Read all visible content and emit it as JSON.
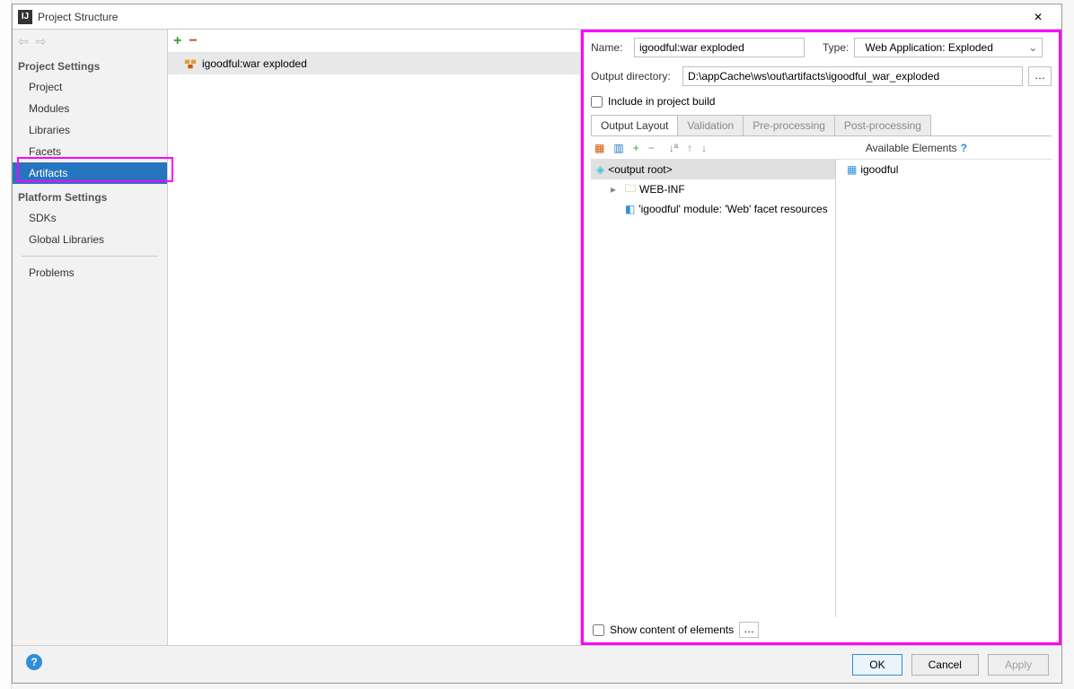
{
  "window": {
    "title": "Project Structure"
  },
  "sidebar": {
    "section1": "Project Settings",
    "items1": [
      "Project",
      "Modules",
      "Libraries",
      "Facets",
      "Artifacts"
    ],
    "selectedIndex": 4,
    "section2": "Platform Settings",
    "items2": [
      "SDKs",
      "Global Libraries"
    ],
    "problems": "Problems"
  },
  "mid": {
    "artifact_name": "igoodful:war exploded"
  },
  "right": {
    "name_label": "Name:",
    "name_value": "igoodful:war exploded",
    "type_label": "Type:",
    "type_value": "Web Application: Exploded",
    "outdir_label": "Output directory:",
    "outdir_value": "D:\\appCache\\ws\\out\\artifacts\\igoodful_war_exploded",
    "include_label": "Include in project build",
    "tabs": [
      "Output Layout",
      "Validation",
      "Pre-processing",
      "Post-processing"
    ],
    "available_label": "Available Elements",
    "tree_left": {
      "root": "<output root>",
      "child1": "WEB-INF",
      "child2": "'igoodful' module: 'Web' facet resources"
    },
    "tree_right": {
      "root": "igoodful"
    },
    "show_content_label": "Show content of elements"
  },
  "buttons": {
    "ok": "OK",
    "cancel": "Cancel",
    "apply": "Apply"
  }
}
